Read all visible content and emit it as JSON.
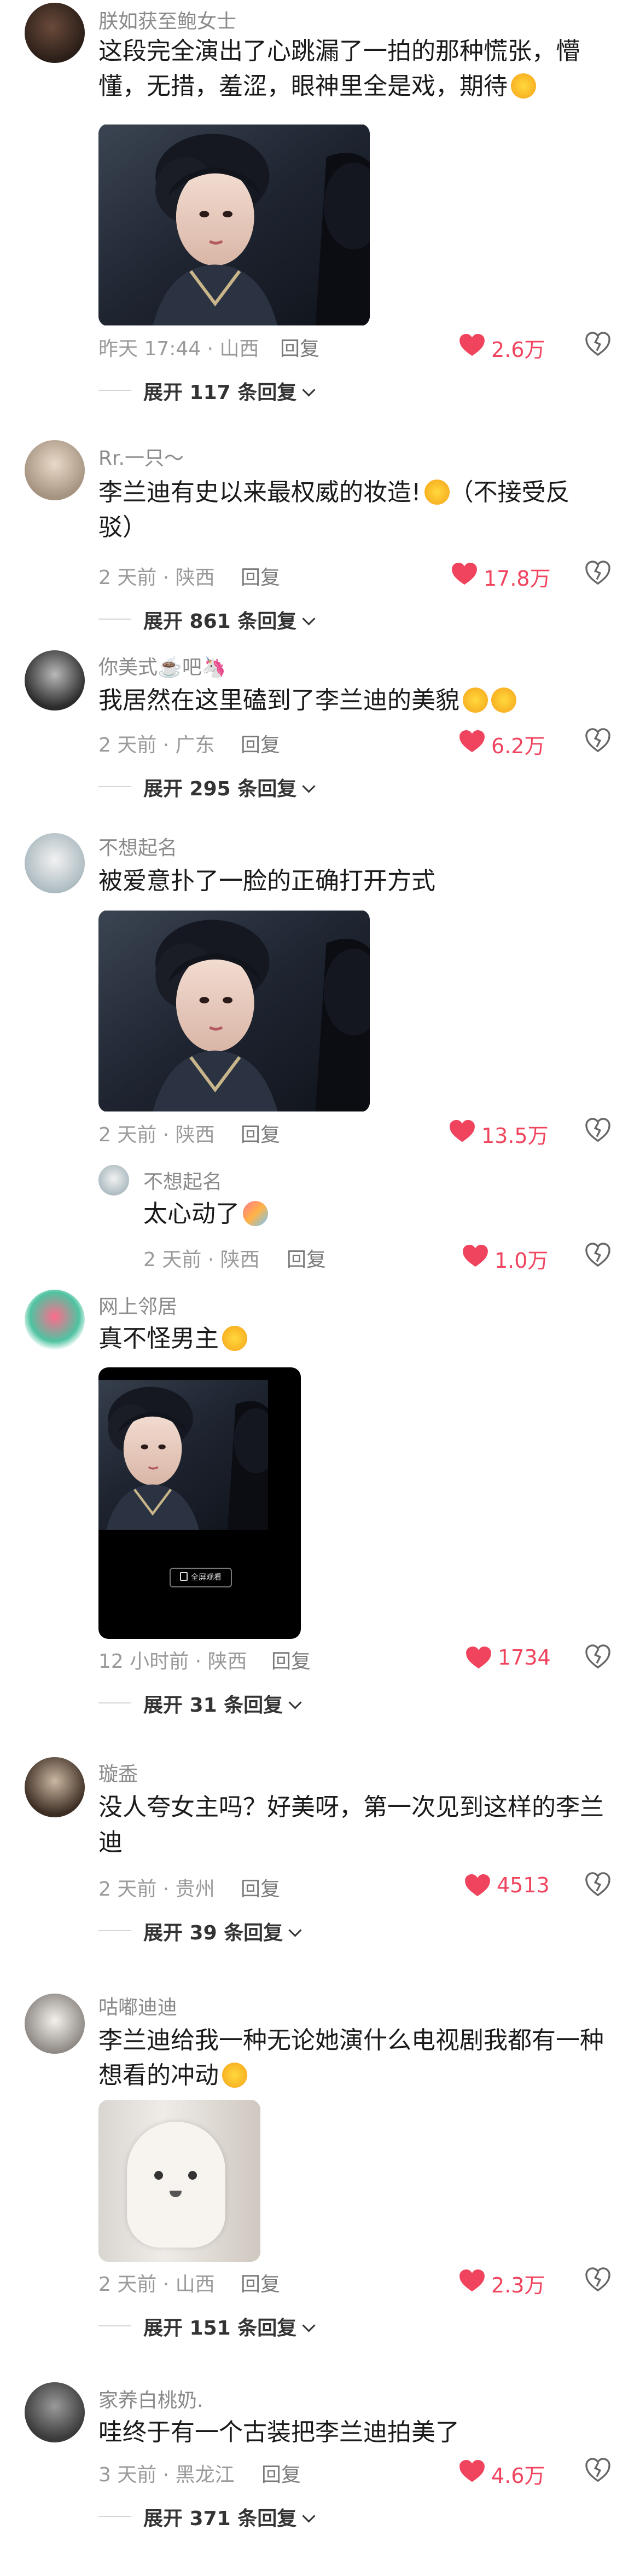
{
  "comments": [
    {
      "username": "朕如获至鲍女士",
      "text": "这段完全演出了心跳漏了一拍的那种慌张，懵懂，无措，羞涩，眼神里全是戏，期待",
      "meta": "昨天 17:44 · 山西",
      "reply": "回复",
      "likes": "2.6万",
      "expand": "展开 117 条回复"
    },
    {
      "username": "Rr.一只～",
      "text": "李兰迪有史以来最权威的妆造!",
      "text_suffix": "（不接受反驳）",
      "meta": "2 天前 · 陕西",
      "reply": "回复",
      "likes": "17.8万",
      "expand": "展开 861 条回复"
    },
    {
      "username": "你美式☕️吧🦄",
      "text": "我居然在这里磕到了李兰迪的美貌",
      "meta": "2 天前 · 广东",
      "reply": "回复",
      "likes": "6.2万",
      "expand": "展开 295 条回复"
    },
    {
      "username": "不想起名",
      "text": "被爱意扑了一脸的正确打开方式",
      "meta": "2 天前 · 陕西",
      "reply": "回复",
      "likes": "13.5万",
      "sub": {
        "username": "不想起名",
        "text": "太心动了",
        "meta": "2 天前 · 陕西",
        "reply": "回复",
        "likes": "1.0万"
      }
    },
    {
      "username": "网上邻居",
      "text": "真不怪男主",
      "video_label": "全屏观看",
      "meta": "12 小时前 · 陕西",
      "reply": "回复",
      "likes": "1734",
      "expand": "展开 31 条回复"
    },
    {
      "username": "璇盉",
      "text": "没人夸女主吗？好美呀，第一次见到这样的李兰迪",
      "meta": "2 天前 · 贵州",
      "reply": "回复",
      "likes": "4513",
      "expand": "展开 39 条回复"
    },
    {
      "username": "咕嘟迪迪",
      "text": "李兰迪给我一种无论她演什么电视剧我都有一种想看的冲动",
      "meta": "2 天前 · 山西",
      "reply": "回复",
      "likes": "2.3万",
      "expand": "展开 151 条回复"
    },
    {
      "username": "家养白桃奶.",
      "text": "哇终于有一个古装把李兰迪拍美了",
      "meta": "3 天前 · 黑龙江",
      "reply": "回复",
      "likes": "4.6万",
      "expand": "展开 371 条回复"
    }
  ],
  "colors": {
    "like_red": "#f0445e",
    "meta_gray": "#9a9a9a",
    "background": "#ffffff"
  },
  "icons": [
    "heart-icon",
    "dislike-heart-icon",
    "chevron-down-icon",
    "fullscreen-icon"
  ]
}
